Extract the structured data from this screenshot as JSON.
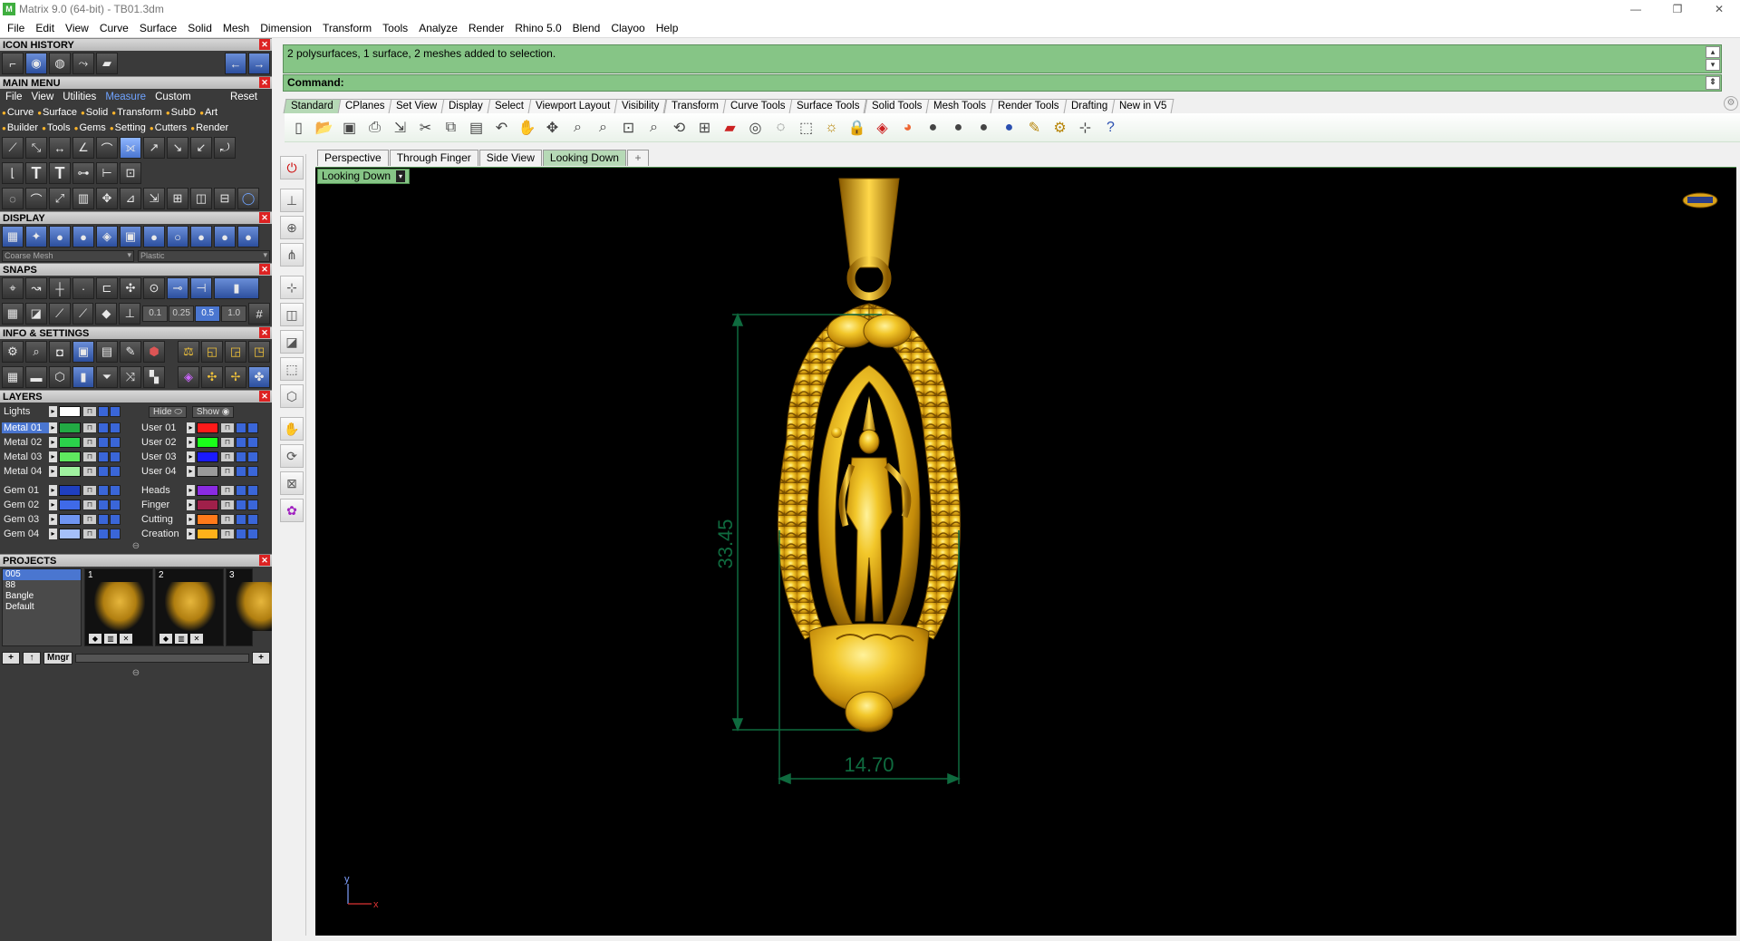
{
  "window": {
    "title": "Matrix 9.0 (64-bit) - TB01.3dm",
    "app_icon": "matrix-logo-icon",
    "controls": [
      "minimize-icon",
      "restore-icon",
      "close-icon"
    ]
  },
  "menubar": [
    "File",
    "Edit",
    "View",
    "Curve",
    "Surface",
    "Solid",
    "Mesh",
    "Dimension",
    "Transform",
    "Tools",
    "Analyze",
    "Render",
    "Rhino 5.0",
    "Blend",
    "Clayoo",
    "Help"
  ],
  "left_panel": {
    "icon_history": {
      "title": "ICON HISTORY"
    },
    "main_menu": {
      "title": "MAIN MENU",
      "tabs": [
        "File",
        "View",
        "Utilities",
        "Measure",
        "Custom"
      ],
      "active_tab": "Measure",
      "reset_label": "Reset",
      "categories_row1": [
        "Curve",
        "Surface",
        "Solid",
        "Transform",
        "SubD",
        "Art"
      ],
      "categories_row2": [
        "Builder",
        "Tools",
        "Gems",
        "Setting",
        "Cutters",
        "Render"
      ]
    },
    "display": {
      "title": "DISPLAY",
      "mesh_dropdown": "Coarse Mesh",
      "material_dropdown": "Plastic"
    },
    "snaps": {
      "title": "SNAPS",
      "values": [
        "0.1",
        "0.25",
        "0.5",
        "1.0"
      ],
      "active_value": "0.5"
    },
    "info_settings": {
      "title": "INFO & SETTINGS"
    },
    "layers": {
      "title": "LAYERS",
      "lights_label": "Lights",
      "hide_label": "Hide",
      "show_label": "Show",
      "left": [
        {
          "name": "Metal 01",
          "color": "#22aa44",
          "selected": true
        },
        {
          "name": "Metal 02",
          "color": "#2bd24b"
        },
        {
          "name": "Metal 03",
          "color": "#5fe85f"
        },
        {
          "name": "Metal 04",
          "color": "#9ff09f"
        },
        {
          "name": "Gem 01",
          "color": "#1f3fbf"
        },
        {
          "name": "Gem 02",
          "color": "#3f6ae8"
        },
        {
          "name": "Gem 03",
          "color": "#6f95f2"
        },
        {
          "name": "Gem 04",
          "color": "#a5c0f8"
        }
      ],
      "right": [
        {
          "name": "User 01",
          "color": "#ff1a1a"
        },
        {
          "name": "User 02",
          "color": "#1aff1a"
        },
        {
          "name": "User 03",
          "color": "#1a1aff"
        },
        {
          "name": "User 04",
          "color": "#9a9a9a"
        },
        {
          "name": "Heads",
          "color": "#8a2be2"
        },
        {
          "name": "Finger",
          "color": "#a0204a"
        },
        {
          "name": "Cutting",
          "color": "#ff7a1a"
        },
        {
          "name": "Creation",
          "color": "#ffb21a"
        }
      ]
    },
    "projects": {
      "title": "PROJECTS",
      "list": [
        "005",
        "88",
        "Bangle",
        "Default"
      ],
      "selected": "005",
      "thumbs": [
        "1",
        "2",
        "3"
      ],
      "manager_label": "Mngr"
    }
  },
  "command": {
    "history": "2 polysurfaces, 1 surface, 2 meshes added to selection.",
    "prompt": "Command:"
  },
  "toolbar_tabs": [
    "Standard",
    "CPlanes",
    "Set View",
    "Display",
    "Select",
    "Viewport Layout",
    "Visibility",
    "Transform",
    "Curve Tools",
    "Surface Tools",
    "Solid Tools",
    "Mesh Tools",
    "Render Tools",
    "Drafting",
    "New in V5"
  ],
  "active_toolbar_tab": "Standard",
  "toolbar_icons": [
    "new-file-icon",
    "open-icon",
    "save-icon",
    "print-icon",
    "import-icon",
    "cut-icon",
    "copy-icon",
    "paste-icon",
    "undo-icon",
    "pan-hand-icon",
    "move-view-icon",
    "zoom-dynamic-icon",
    "zoom-window-icon",
    "zoom-extents-icon",
    "zoom-selected-icon",
    "undo-view-icon",
    "four-viewports-icon",
    "car-icon",
    "show-objects-icon",
    "hide-objects-icon",
    "select-icon",
    "light-bulb-icon",
    "lock-icon",
    "layer-icon",
    "color-wheel-icon",
    "shaded-sphere-icon",
    "rendered-sphere-icon",
    "material-sphere-icon",
    "blue-sphere-icon",
    "options-icon",
    "gear-settings-icon",
    "grid-snap-icon",
    "help-icon"
  ],
  "viewport_tabs": [
    "Perspective",
    "Through Finger",
    "Side View",
    "Looking Down"
  ],
  "active_viewport_tab": "Looking Down",
  "viewport": {
    "label": "Looking Down",
    "dimension_height": "33.45",
    "dimension_width": "14.70",
    "axis_y": "y",
    "axis_x": "x"
  },
  "colors": {
    "command_green": "#86c586",
    "dimension_green": "#0f6b3f",
    "gold": "#d4a017",
    "panel_dark": "#3a3a3a",
    "accent_blue": "#4a76d0"
  }
}
